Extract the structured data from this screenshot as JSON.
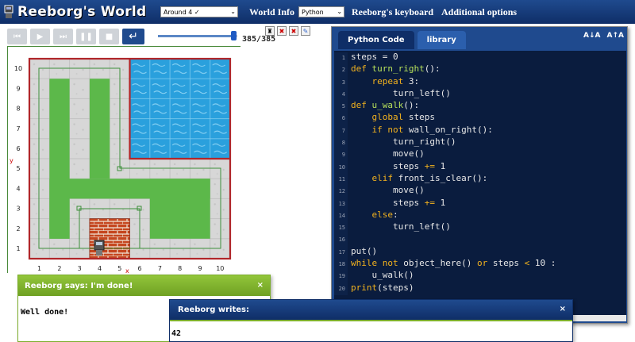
{
  "header": {
    "app_title": "Reeborg's World",
    "world_select_value": "Around 4 ✓",
    "world_info_label": "World Info",
    "language_select_value": "Python",
    "keyboard_label": "Reeborg's keyboard",
    "options_label": "Additional options"
  },
  "controls": {
    "buttons": [
      "reload-icon",
      "run-icon",
      "step-icon",
      "pause-icon",
      "stop-icon",
      "return-icon"
    ],
    "step_counter": "385/385",
    "slider_fraction": 0.95
  },
  "world": {
    "x_axis_labels": [
      "1",
      "2",
      "3",
      "4",
      "5",
      "6",
      "7",
      "8",
      "9",
      "10"
    ],
    "y_axis_labels": [
      "1",
      "2",
      "3",
      "4",
      "5",
      "6",
      "7",
      "8",
      "9",
      "10"
    ],
    "x_axis_letter": "x",
    "y_axis_letter": "y"
  },
  "editor": {
    "tabs": [
      "Python Code",
      "library"
    ],
    "font_buttons": [
      "A↓A",
      "A↑A"
    ],
    "code_lines": [
      "steps = 0",
      "def turn_right():",
      "    repeat 3:",
      "        turn_left()",
      "def u_walk():",
      "    global steps",
      "    if not wall_on_right():",
      "        turn_right()",
      "        move()",
      "        steps += 1",
      "    elif front_is_clear():",
      "        move()",
      "        steps += 1",
      "    else:",
      "        turn_left()",
      "",
      "put()",
      "while not object_here() or steps < 10 :",
      "    u_walk()",
      "print(steps)"
    ]
  },
  "dialogs": {
    "says_title": "Reeborg says: I'm done!",
    "says_body": "Well done!",
    "writes_title": "Reeborg writes:",
    "writes_body": "42",
    "close_symbol": "×"
  },
  "colors": {
    "header_blue": "#1f4a8e",
    "grass": "#5cb84a",
    "water": "#2aa0dd",
    "wall": "#b0262a",
    "brick": "#c5461f",
    "dialog_green": "#7cae2c"
  }
}
